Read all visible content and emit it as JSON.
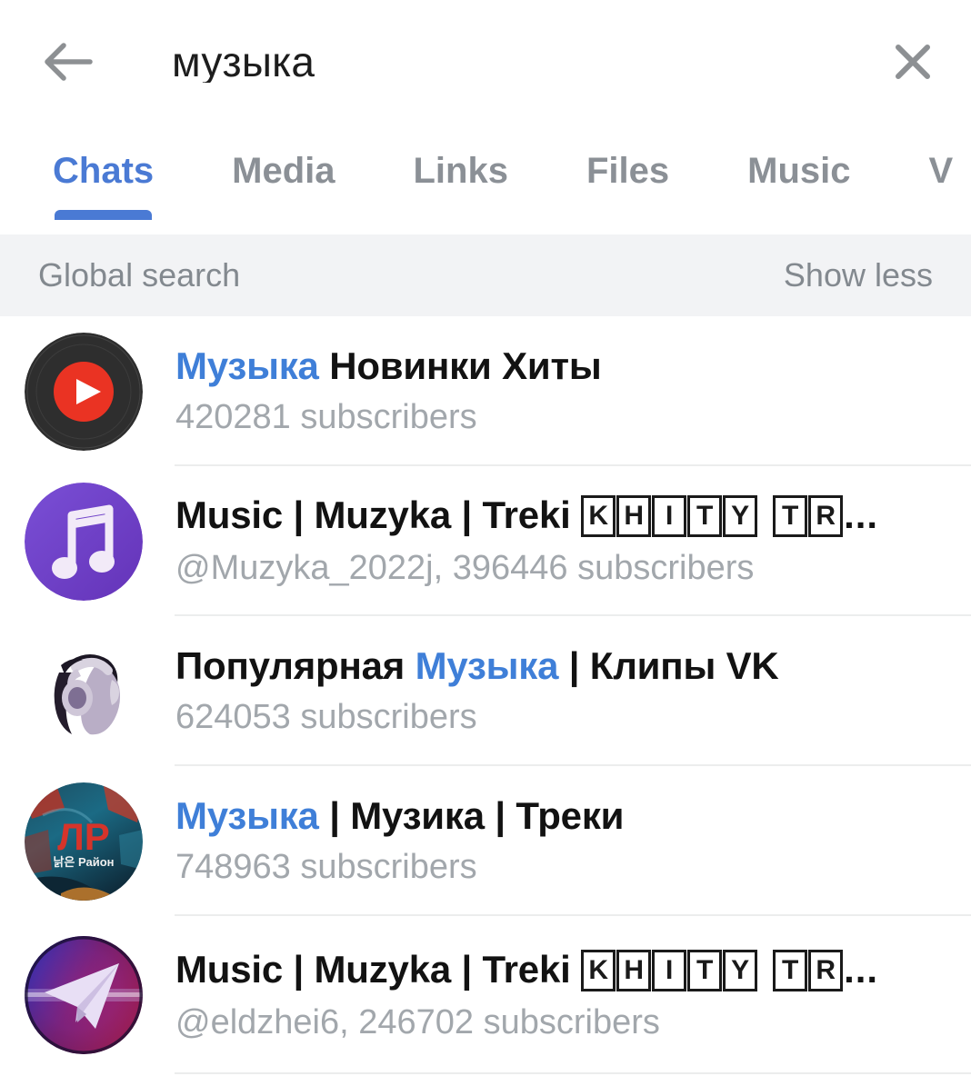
{
  "header": {
    "back_icon": "arrow-left-icon",
    "search_value": "музыка",
    "clear_icon": "close-icon"
  },
  "tabs": {
    "items": [
      {
        "label": "Chats",
        "active": true
      },
      {
        "label": "Media",
        "active": false
      },
      {
        "label": "Links",
        "active": false
      },
      {
        "label": "Files",
        "active": false
      },
      {
        "label": "Music",
        "active": false
      },
      {
        "label": "V",
        "active": false
      }
    ]
  },
  "global_search": {
    "label": "Global search",
    "action_label": "Show less"
  },
  "results": [
    {
      "avatar": "youtube-music-vinyl-avatar",
      "title_highlight": "Музыка",
      "title_rest": " Новинки Хиты",
      "subtitle": "420281 subscribers"
    },
    {
      "avatar": "purple-music-note-avatar",
      "title_plain": "Music | Muzyka | Treki ",
      "title_tofu": [
        "K",
        "H",
        "I",
        "T",
        "Y",
        "T",
        "R"
      ],
      "title_ellipsis": "...",
      "subtitle": "@Muzyka_2022j, 396446 subscribers"
    },
    {
      "avatar": "girl-headphones-photo-avatar",
      "title_before": "Популярная ",
      "title_highlight": "Музыка",
      "title_rest": " | Клипы VK",
      "subtitle": "624053 subscribers"
    },
    {
      "avatar": "lr-artwork-avatar",
      "avatar_text": "ЛР",
      "avatar_subtext": "낡은 Район",
      "title_highlight": "Музыка",
      "title_rest": " | Музика | Треки",
      "subtitle": "748963 subscribers"
    },
    {
      "avatar": "telegram-plane-gradient-avatar",
      "title_plain": "Music | Muzyka | Treki ",
      "title_tofu": [
        "K",
        "H",
        "I",
        "T",
        "Y",
        "T",
        "R"
      ],
      "title_ellipsis": "...",
      "subtitle": "@eldzhei6, 246702 subscribers"
    }
  ],
  "colors": {
    "accent": "#4a7ad4",
    "highlight": "#3f7fd8",
    "muted": "#a2a7ac",
    "tab_inactive": "#8b9096",
    "global_bar_bg": "#f2f3f5"
  }
}
